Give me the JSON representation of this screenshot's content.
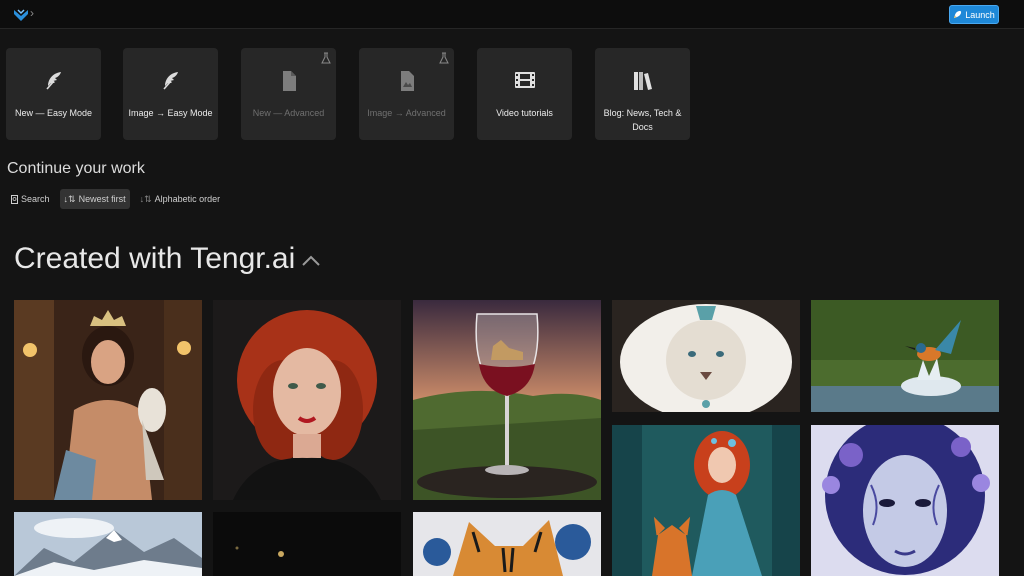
{
  "header": {
    "launch_label": "Launch",
    "launch_icon": "rocket-icon",
    "logo_icon": "tengr-logo-icon"
  },
  "cards": [
    {
      "label": "New — Easy Mode",
      "icon": "feather-icon",
      "enabled": true,
      "experimental": false
    },
    {
      "label": "Image → Easy Mode",
      "icon": "feather-icon",
      "enabled": true,
      "experimental": false
    },
    {
      "label": "New — Advanced",
      "icon": "file-icon",
      "enabled": false,
      "experimental": true
    },
    {
      "label": "Image → Advanced",
      "icon": "image-file-icon",
      "enabled": false,
      "experimental": true
    },
    {
      "label": "Video tutorials",
      "icon": "film-icon",
      "enabled": true,
      "experimental": false
    },
    {
      "label": "Blog: News, Tech & Docs",
      "icon": "books-icon",
      "enabled": true,
      "experimental": false
    }
  ],
  "continue": {
    "title": "Continue your work",
    "filters": [
      {
        "label": "Search",
        "icon": "search-icon",
        "active": false
      },
      {
        "label": "Newest first",
        "icon": "sort-icon",
        "active": true
      },
      {
        "label": "Alphabetic order",
        "icon": "sort-alpha-icon",
        "active": false
      }
    ]
  },
  "created": {
    "title": "Created with Tengr.ai",
    "toggle_icon": "chevron-up-icon"
  },
  "gallery": [
    {
      "subject": "queen with falcon"
    },
    {
      "subject": "red-haired woman"
    },
    {
      "subject": "wine glass with vineyard"
    },
    {
      "subject": "white lion"
    },
    {
      "subject": "kingfisher over water"
    },
    {
      "subject": "red-haired fairy with fox"
    },
    {
      "subject": "blue floral face"
    },
    {
      "subject": "snowy mountains"
    },
    {
      "subject": "dark bokeh"
    },
    {
      "subject": "tiger painting"
    }
  ],
  "colors": {
    "accent": "#1e88d8",
    "background": "#141414",
    "card": "#272727"
  }
}
